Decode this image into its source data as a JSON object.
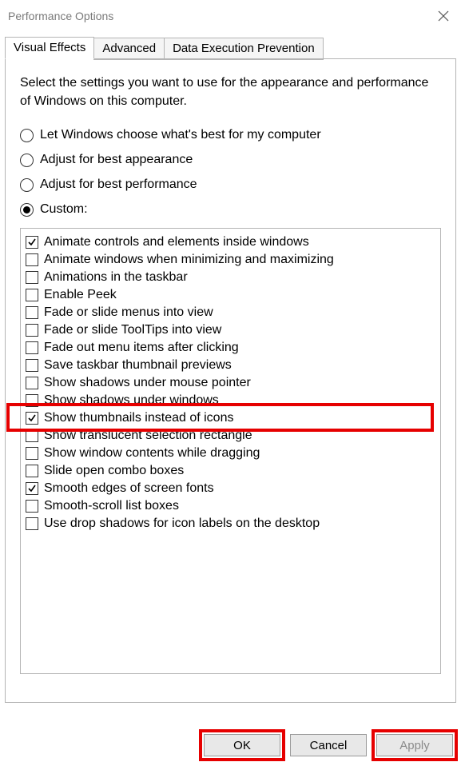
{
  "window": {
    "title": "Performance Options"
  },
  "tabs": [
    {
      "label": "Visual Effects",
      "active": true
    },
    {
      "label": "Advanced",
      "active": false
    },
    {
      "label": "Data Execution Prevention",
      "active": false
    }
  ],
  "intro": "Select the settings you want to use for the appearance and performance of Windows on this computer.",
  "radios": [
    {
      "label": "Let Windows choose what's best for my computer",
      "selected": false
    },
    {
      "label": "Adjust for best appearance",
      "selected": false
    },
    {
      "label": "Adjust for best performance",
      "selected": false
    },
    {
      "label": "Custom:",
      "selected": true
    }
  ],
  "options": [
    {
      "label": "Animate controls and elements inside windows",
      "checked": true,
      "highlighted": false
    },
    {
      "label": "Animate windows when minimizing and maximizing",
      "checked": false,
      "highlighted": false
    },
    {
      "label": "Animations in the taskbar",
      "checked": false,
      "highlighted": false
    },
    {
      "label": "Enable Peek",
      "checked": false,
      "highlighted": false
    },
    {
      "label": "Fade or slide menus into view",
      "checked": false,
      "highlighted": false
    },
    {
      "label": "Fade or slide ToolTips into view",
      "checked": false,
      "highlighted": false
    },
    {
      "label": "Fade out menu items after clicking",
      "checked": false,
      "highlighted": false
    },
    {
      "label": "Save taskbar thumbnail previews",
      "checked": false,
      "highlighted": false
    },
    {
      "label": "Show shadows under mouse pointer",
      "checked": false,
      "highlighted": false
    },
    {
      "label": "Show shadows under windows",
      "checked": false,
      "highlighted": false
    },
    {
      "label": "Show thumbnails instead of icons",
      "checked": true,
      "highlighted": true
    },
    {
      "label": "Show translucent selection rectangle",
      "checked": false,
      "highlighted": false
    },
    {
      "label": "Show window contents while dragging",
      "checked": false,
      "highlighted": false
    },
    {
      "label": "Slide open combo boxes",
      "checked": false,
      "highlighted": false
    },
    {
      "label": "Smooth edges of screen fonts",
      "checked": true,
      "highlighted": false
    },
    {
      "label": "Smooth-scroll list boxes",
      "checked": false,
      "highlighted": false
    },
    {
      "label": "Use drop shadows for icon labels on the desktop",
      "checked": false,
      "highlighted": false
    }
  ],
  "buttons": {
    "ok": {
      "label": "OK",
      "highlighted": true
    },
    "cancel": {
      "label": "Cancel",
      "highlighted": false
    },
    "apply": {
      "label": "Apply",
      "highlighted": true,
      "disabled": true
    }
  }
}
